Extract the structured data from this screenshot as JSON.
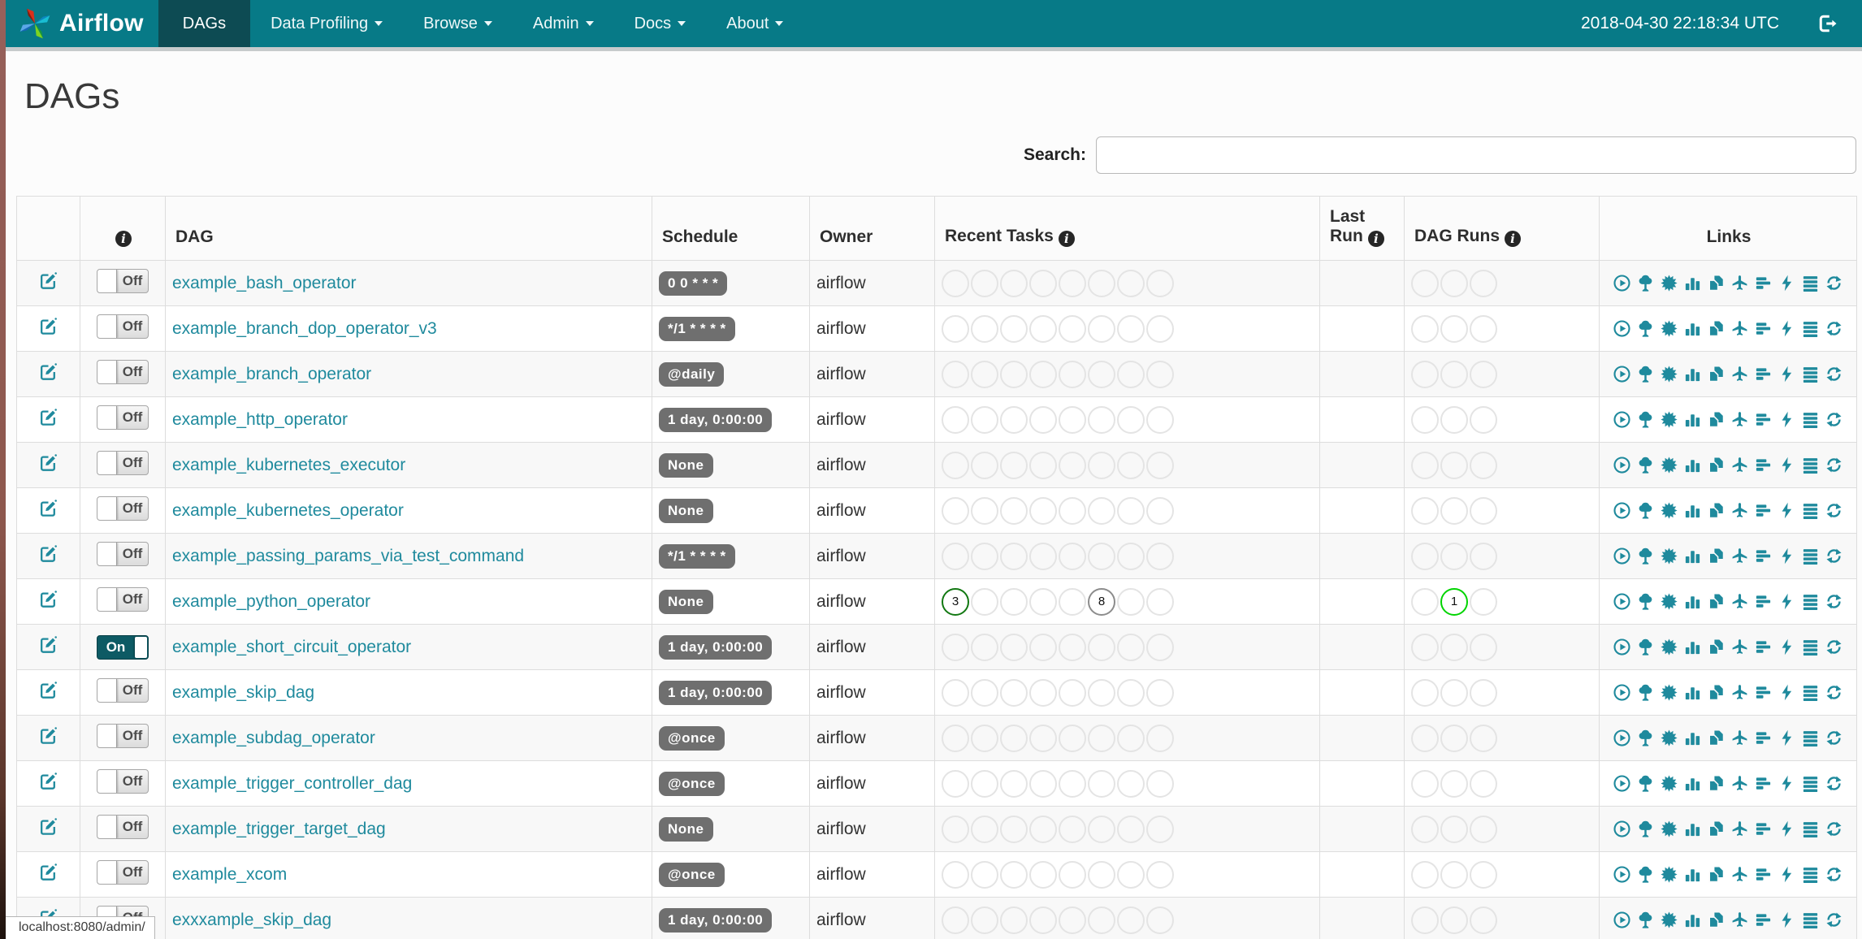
{
  "navbar": {
    "brand": "Airflow",
    "menu": [
      {
        "label": "DAGs",
        "active": true,
        "caret": false
      },
      {
        "label": "Data Profiling",
        "active": false,
        "caret": true
      },
      {
        "label": "Browse",
        "active": false,
        "caret": true
      },
      {
        "label": "Admin",
        "active": false,
        "caret": true
      },
      {
        "label": "Docs",
        "active": false,
        "caret": true
      },
      {
        "label": "About",
        "active": false,
        "caret": true
      }
    ],
    "clock": "2018-04-30 22:18:34 UTC"
  },
  "page": {
    "title": "DAGs",
    "search_label": "Search:",
    "status_bar": "localhost:8080/admin/"
  },
  "table": {
    "headers": {
      "dag": "DAG",
      "schedule": "Schedule",
      "owner": "Owner",
      "recent_tasks": "Recent Tasks",
      "last_run_line1": "Last",
      "last_run_line2": "Run",
      "dag_runs": "DAG Runs",
      "links": "Links"
    },
    "recent_task_slots": 8,
    "dag_run_slots": 3,
    "rows": [
      {
        "name": "example_bash_operator",
        "toggle": "Off",
        "schedule": "0 0 * * *",
        "owner": "airflow",
        "last_run": "",
        "recent_tasks": [],
        "dag_runs": []
      },
      {
        "name": "example_branch_dop_operator_v3",
        "toggle": "Off",
        "schedule": "*/1 * * * *",
        "owner": "airflow",
        "last_run": "",
        "recent_tasks": [],
        "dag_runs": []
      },
      {
        "name": "example_branch_operator",
        "toggle": "Off",
        "schedule": "@daily",
        "owner": "airflow",
        "last_run": "",
        "recent_tasks": [],
        "dag_runs": []
      },
      {
        "name": "example_http_operator",
        "toggle": "Off",
        "schedule": "1 day, 0:00:00",
        "owner": "airflow",
        "last_run": "",
        "recent_tasks": [],
        "dag_runs": []
      },
      {
        "name": "example_kubernetes_executor",
        "toggle": "Off",
        "schedule": "None",
        "owner": "airflow",
        "last_run": "",
        "recent_tasks": [],
        "dag_runs": []
      },
      {
        "name": "example_kubernetes_operator",
        "toggle": "Off",
        "schedule": "None",
        "owner": "airflow",
        "last_run": "",
        "recent_tasks": [],
        "dag_runs": []
      },
      {
        "name": "example_passing_params_via_test_command",
        "toggle": "Off",
        "schedule": "*/1 * * * *",
        "owner": "airflow",
        "last_run": "",
        "recent_tasks": [],
        "dag_runs": []
      },
      {
        "name": "example_python_operator",
        "toggle": "Off",
        "schedule": "None",
        "owner": "airflow",
        "last_run": "",
        "recent_tasks": [
          {
            "slot": 0,
            "count": "3",
            "state": "success"
          },
          {
            "slot": 5,
            "count": "8",
            "state": "queued"
          }
        ],
        "dag_runs": [
          {
            "slot": 1,
            "count": "1",
            "state": "running"
          }
        ]
      },
      {
        "name": "example_short_circuit_operator",
        "toggle": "On",
        "schedule": "1 day, 0:00:00",
        "owner": "airflow",
        "last_run": "",
        "recent_tasks": [],
        "dag_runs": []
      },
      {
        "name": "example_skip_dag",
        "toggle": "Off",
        "schedule": "1 day, 0:00:00",
        "owner": "airflow",
        "last_run": "",
        "recent_tasks": [],
        "dag_runs": []
      },
      {
        "name": "example_subdag_operator",
        "toggle": "Off",
        "schedule": "@once",
        "owner": "airflow",
        "last_run": "",
        "recent_tasks": [],
        "dag_runs": []
      },
      {
        "name": "example_trigger_controller_dag",
        "toggle": "Off",
        "schedule": "@once",
        "owner": "airflow",
        "last_run": "",
        "recent_tasks": [],
        "dag_runs": []
      },
      {
        "name": "example_trigger_target_dag",
        "toggle": "Off",
        "schedule": "None",
        "owner": "airflow",
        "last_run": "",
        "recent_tasks": [],
        "dag_runs": []
      },
      {
        "name": "example_xcom",
        "toggle": "Off",
        "schedule": "@once",
        "owner": "airflow",
        "last_run": "",
        "recent_tasks": [],
        "dag_runs": []
      },
      {
        "name": "exxxample_skip_dag",
        "toggle": "Off",
        "schedule": "1 day, 0:00:00",
        "owner": "airflow",
        "last_run": "",
        "recent_tasks": [],
        "dag_runs": []
      }
    ]
  },
  "links": [
    "trigger-dag",
    "tree-view",
    "graph-view",
    "task-duration",
    "task-tries",
    "landing-times",
    "gantt-view",
    "code-view",
    "log-view",
    "refresh"
  ],
  "colors": {
    "navbar": "#077a87",
    "navbar_active": "#0d4b53",
    "link_teal": "#1f8a9d",
    "badge_bg": "#6f6f6f",
    "state_success": "#127812",
    "state_running": "#00d400",
    "state_queued": "#8c8c8c"
  }
}
